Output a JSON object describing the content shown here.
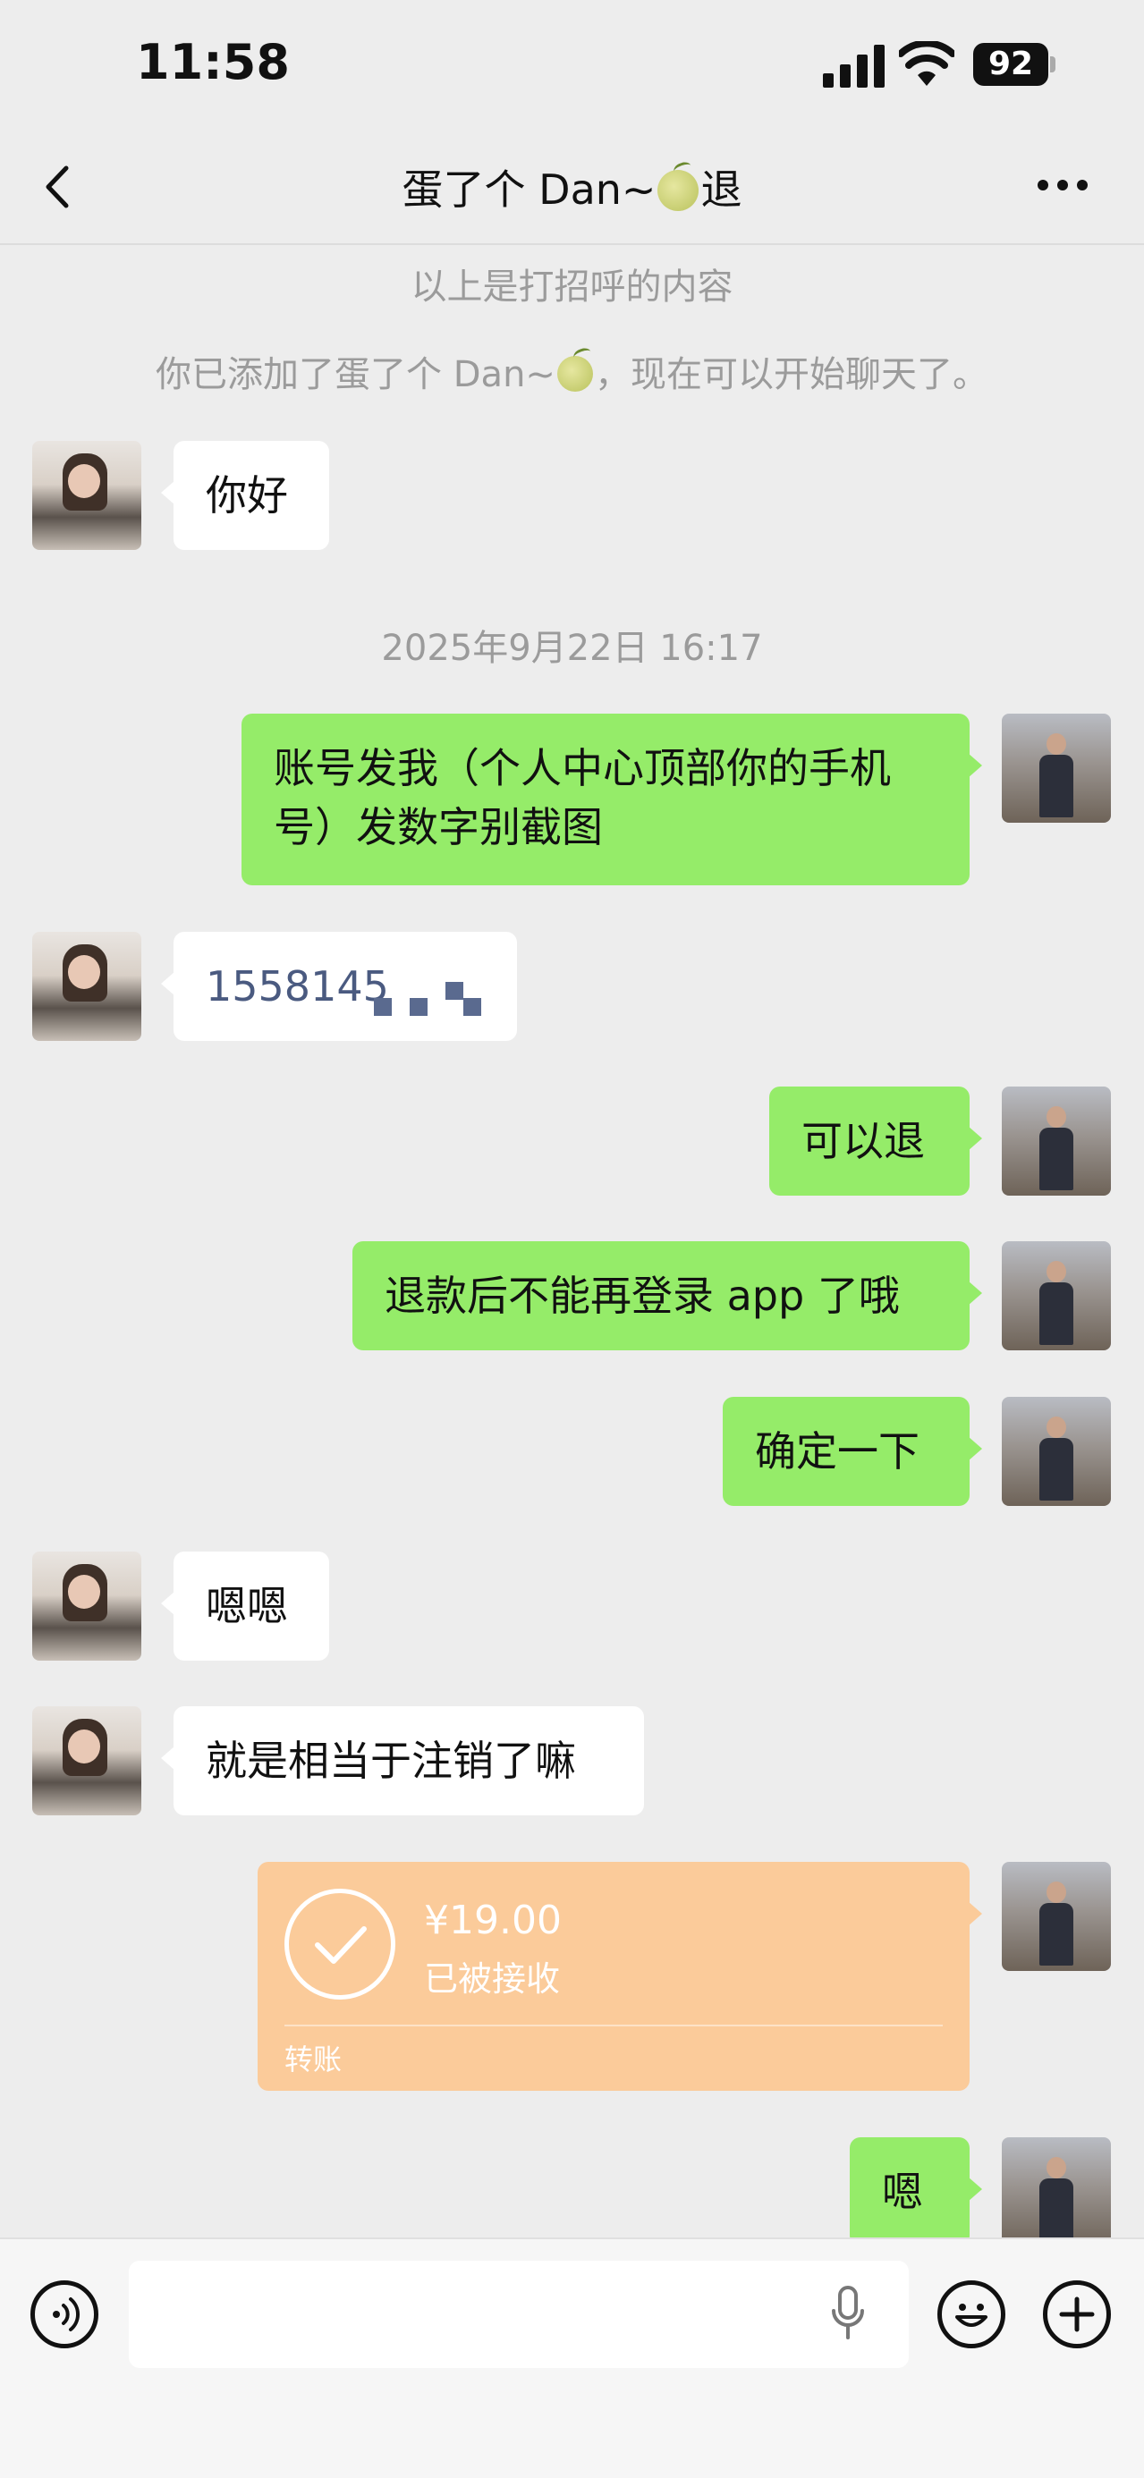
{
  "status_bar": {
    "time": "11:58",
    "battery": "92"
  },
  "nav": {
    "title_prefix": "蛋了个 Dan~",
    "title_suffix": "退"
  },
  "system": {
    "greeting_note": "以上是打招呼的内容",
    "added_prefix": "你已添加了蛋了个 Dan~",
    "added_suffix": "，现在可以开始聊天了。",
    "timestamp": "2025年9月22日 16:17"
  },
  "messages": [
    {
      "side": "in",
      "text": "你好"
    },
    {
      "side": "out",
      "text": "账号发我（个人中心顶部你的手机号）发数字别截图"
    },
    {
      "side": "in",
      "text": "1558145"
    },
    {
      "side": "out",
      "text": "可以退"
    },
    {
      "side": "out",
      "text": "退款后不能再登录 app 了哦"
    },
    {
      "side": "out",
      "text": "确定一下"
    },
    {
      "side": "in",
      "text": "嗯嗯"
    },
    {
      "side": "in",
      "text": "就是相当于注销了嘛"
    },
    {
      "side": "out",
      "text": "嗯"
    }
  ],
  "transfer": {
    "amount": "¥19.00",
    "status": "已被接收",
    "label": "转账"
  },
  "colors": {
    "outgoing_bubble": "#95ec69",
    "incoming_bubble": "#ffffff",
    "transfer_card": "#fbcb9a",
    "background": "#ededed"
  },
  "icons": [
    "back-icon",
    "more-icon",
    "voice-icon",
    "microphone-icon",
    "emoji-icon",
    "plus-icon",
    "check-icon"
  ]
}
